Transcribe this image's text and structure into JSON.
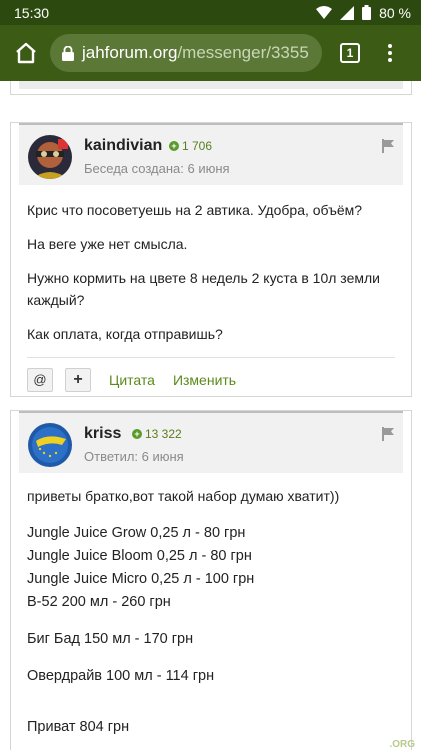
{
  "status": {
    "time": "15:30",
    "battery": "80 %"
  },
  "browser": {
    "domain": "jahforum.org",
    "path": "/messenger/3355",
    "tab_count": "1"
  },
  "posts": [
    {
      "username": "kaindivian",
      "reputation": "1 706",
      "meta": "Беседа создана: 6 июня",
      "paragraphs": [
        "Крис что посоветуешь на 2 автика. Удобра, объём?",
        "На веге уже нет смысла.",
        "Нужно кормить на цвете 8 недель 2 куста в 10л земли каждый?",
        "Как оплата, когда отправишь?"
      ],
      "actions": {
        "mention": "@",
        "add": "+",
        "quote": "Цитата",
        "edit": "Изменить"
      }
    },
    {
      "username": "kriss",
      "reputation": "13 322",
      "meta": "Ответил: 6 июня",
      "intro": "приветы братко,вот такой набор думаю хватит))",
      "items": [
        "Jungle Juice Grow 0,25 л - 80 грн",
        "Jungle Juice Bloom  0,25 л - 80 грн",
        "Jungle Juice Micro 0,25 л - 100 грн",
        "В-52 200 мл  - 260 грн"
      ],
      "item2": "Биг Бад 150 мл - 170 грн",
      "item3": "Овердрайв 100 мл - 114 грн",
      "item4": "Приват 804 грн"
    }
  ],
  "watermark": ".ORG"
}
